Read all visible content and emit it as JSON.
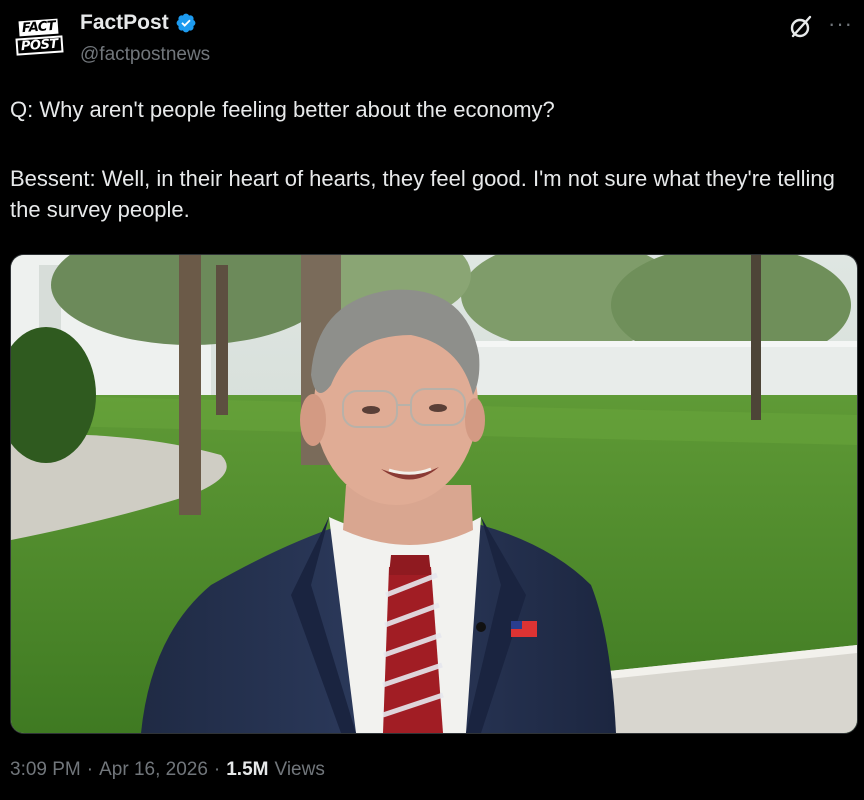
{
  "account": {
    "avatar_line1": "FACT",
    "avatar_line2": "POST",
    "name": "FactPost",
    "handle": "@factpostnews",
    "verified": true
  },
  "icons": {
    "verified": "verified-badge-icon",
    "grok": "grok-icon",
    "more": "more-options-icon"
  },
  "post": {
    "line1": "Q: Why aren't people feeling better about the economy?",
    "line2": "Bessent: Well, in their heart of hearts, they feel good. I'm not sure what they're telling the survey people."
  },
  "meta": {
    "time": "3:09 PM",
    "separator": "·",
    "date": "Apr 16, 2026",
    "views_count": "1.5M",
    "views_label": "Views"
  },
  "colors": {
    "background": "#000000",
    "text": "#e7e9ea",
    "muted": "#71767b",
    "verified": "#1d9bf0"
  }
}
